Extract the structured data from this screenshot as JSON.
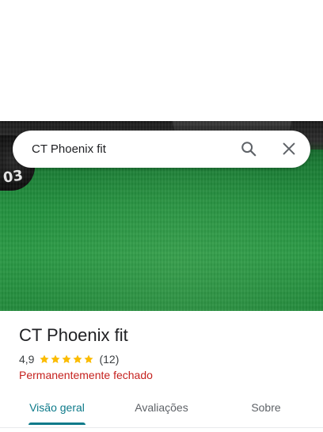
{
  "search": {
    "query": "CT Phoenix fit"
  },
  "photo": {
    "plate_label": "03"
  },
  "place": {
    "title": "CT Phoenix fit",
    "rating_value": "4,9",
    "rating_stars": 5,
    "review_count": "(12)",
    "status": "Permanentemente fechado"
  },
  "tabs": [
    {
      "label": "Visão geral",
      "active": true
    },
    {
      "label": "Avaliações",
      "active": false
    },
    {
      "label": "Sobre",
      "active": false
    }
  ],
  "colors": {
    "star": "#fbbc04",
    "status": "#c5221f",
    "active_tab": "#0d7a8a",
    "icon": "#5f6368"
  },
  "icons": {
    "search": "search-icon",
    "close": "close-icon",
    "star": "star-icon"
  }
}
